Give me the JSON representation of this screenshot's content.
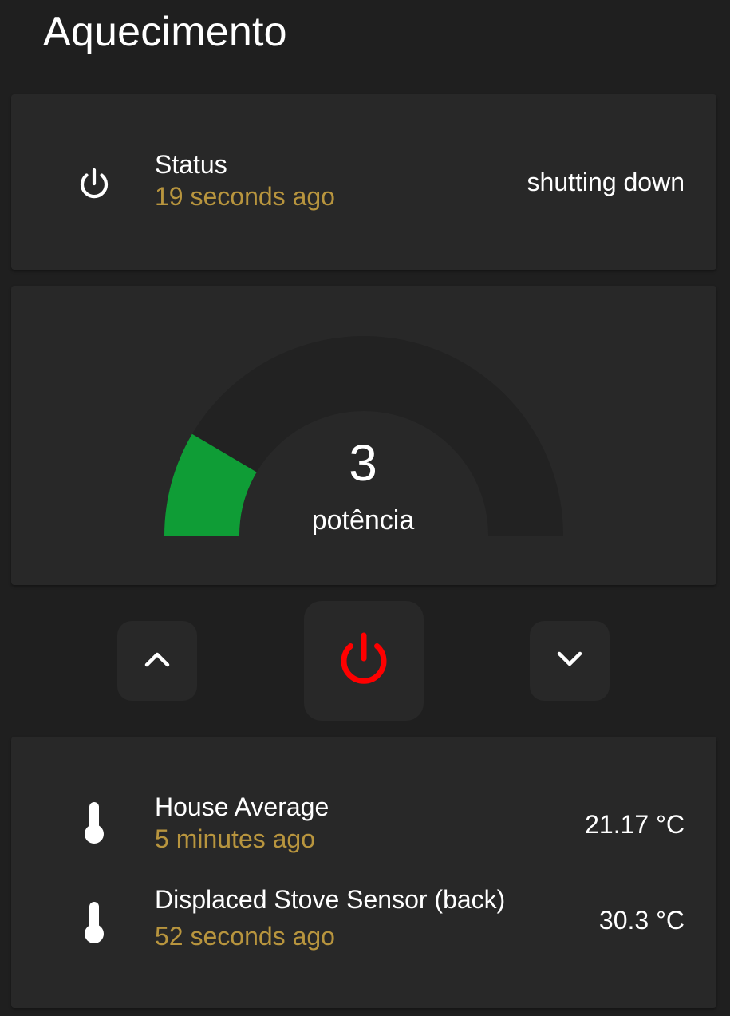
{
  "page": {
    "title": "Aquecimento"
  },
  "status": {
    "name": "Status",
    "last_changed": "19 seconds ago",
    "state": "shutting down",
    "icon": "power-icon"
  },
  "gauge": {
    "value": "3",
    "label": "potência",
    "fill_fraction": 0.17,
    "fill_color": "#0f9d36",
    "track_color": "#222222"
  },
  "controls": {
    "up_icon": "chevron-up-icon",
    "power_icon": "power-icon",
    "power_color": "#ff0000",
    "down_icon": "chevron-down-icon"
  },
  "sensors": [
    {
      "name": "House Average",
      "last_changed": "5 minutes ago",
      "value": "21.17 °C",
      "icon": "thermometer-icon"
    },
    {
      "name": "Displaced Stove Sensor (back)",
      "last_changed": "52 seconds ago",
      "value": "30.3 °C",
      "icon": "thermometer-icon"
    }
  ],
  "colors": {
    "background": "#1f1f1f",
    "card": "#282828",
    "secondary_text": "#b8953e"
  }
}
